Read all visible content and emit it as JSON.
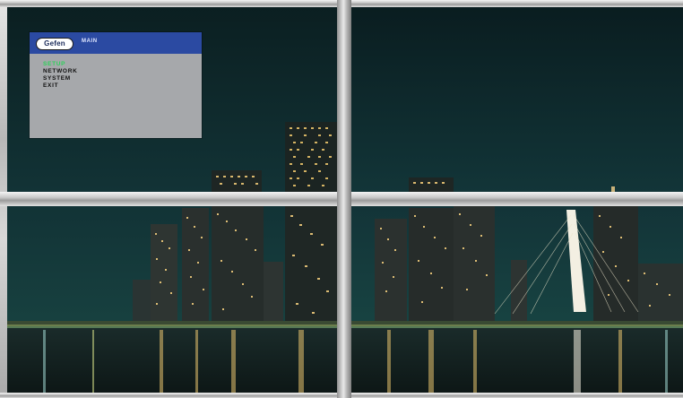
{
  "osd": {
    "brand": "Gefen",
    "title": "MAIN",
    "menu": [
      {
        "label": "SETUP",
        "selected": true
      },
      {
        "label": "NETWORK",
        "selected": false
      },
      {
        "label": "SYSTEM",
        "selected": false
      },
      {
        "label": "EXIT",
        "selected": false
      }
    ],
    "colors": {
      "header": "#2b4aa2",
      "body": "#a6a8ab",
      "selected_text": "#2fd05a",
      "text": "#111111"
    }
  },
  "video_wall": {
    "layout": "2x2",
    "content": "night-city-skyline"
  }
}
